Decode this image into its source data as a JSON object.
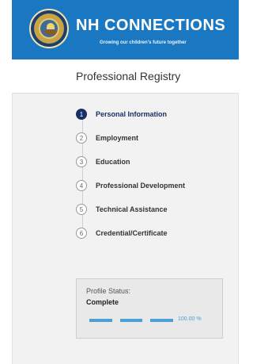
{
  "header": {
    "brand_name": "NH CONNECTIONS",
    "tagline": "Growing our children's future together",
    "logo_icon": "nh-state-seal-icon",
    "color": "#1a78c2"
  },
  "page": {
    "title": "Professional Registry"
  },
  "steps": [
    {
      "number": "1",
      "label": "Personal Information",
      "active": true
    },
    {
      "number": "2",
      "label": "Employment",
      "active": false
    },
    {
      "number": "3",
      "label": "Education",
      "active": false
    },
    {
      "number": "4",
      "label": "Professional Development",
      "active": false
    },
    {
      "number": "5",
      "label": "Technical Assistance",
      "active": false
    },
    {
      "number": "6",
      "label": "Credential/Certificate",
      "active": false
    }
  ],
  "profile_status": {
    "label": "Profile Status:",
    "value": "Complete",
    "progress_text": "100.00 %",
    "progress_fraction": 1.0,
    "progress_color": "#4a9fd5"
  },
  "colors": {
    "active_step": "#182f66"
  }
}
